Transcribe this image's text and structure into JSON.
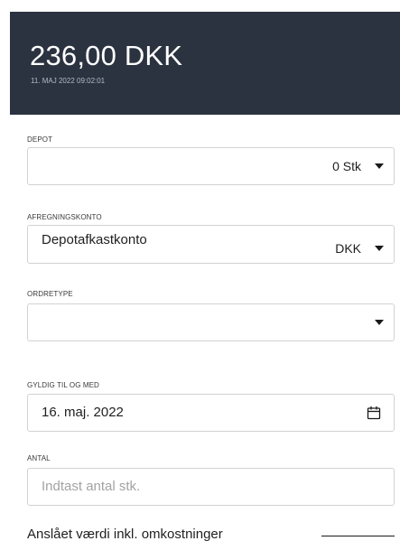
{
  "header": {
    "price": "236,00 DKK",
    "timestamp": "11. MAJ 2022 09:02:01",
    "background_color": "#2b3340"
  },
  "depot": {
    "label": "DEPOT",
    "value": "",
    "quantity": "0 Stk"
  },
  "settlement_account": {
    "label": "AFREGNINGSKONTO",
    "value": "Depotafkastkonto",
    "currency": "DKK"
  },
  "order_type": {
    "label": "ORDRETYPE",
    "value": ""
  },
  "valid_until": {
    "label": "GYLDIG TIL OG MED",
    "value": "16. maj. 2022",
    "icon": "calendar-icon"
  },
  "quantity": {
    "label": "ANTAL",
    "placeholder": "Indtast antal stk."
  },
  "estimate": {
    "label": "Anslået værdi inkl. omkostninger"
  },
  "icons": {
    "dropdown": "chevron-down-icon",
    "date": "calendar-icon"
  }
}
